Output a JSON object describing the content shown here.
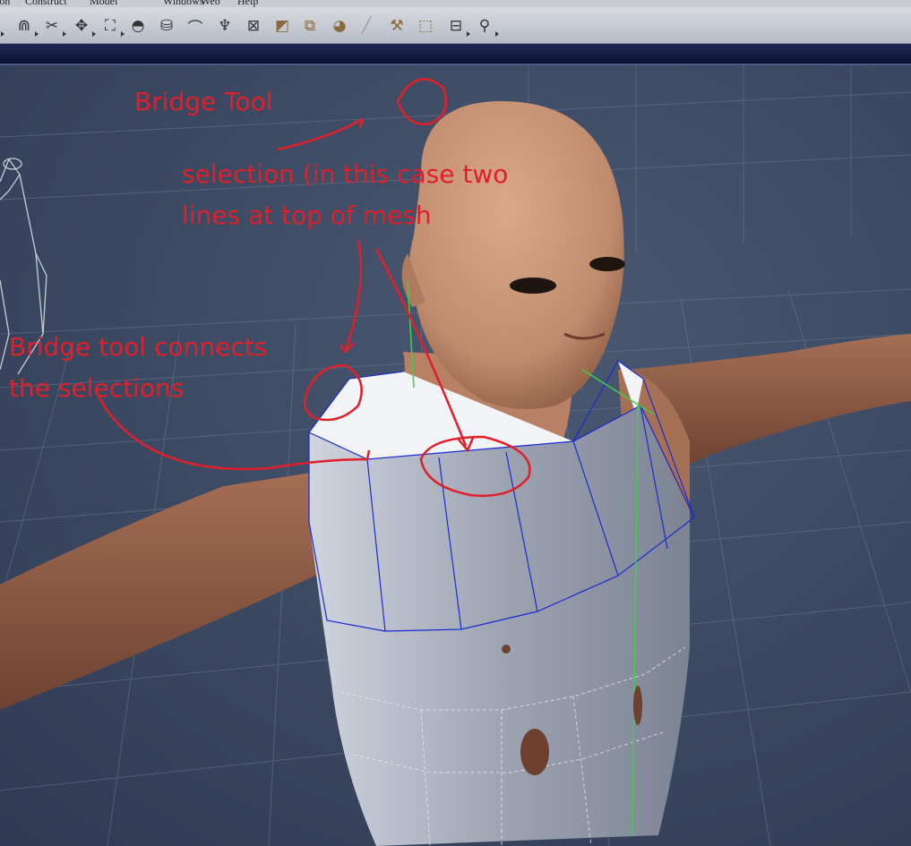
{
  "menu": {
    "items": [
      "ion",
      "Construct",
      "Model",
      "Windows",
      "Web",
      "Help"
    ]
  },
  "toolbar": {
    "tools": [
      {
        "icon": "magnet-icon",
        "glyph": "⋒"
      },
      {
        "icon": "scissors-icon",
        "glyph": "✂"
      },
      {
        "icon": "transform-icon",
        "glyph": "✥"
      },
      {
        "icon": "scale-icon",
        "glyph": "⛶"
      },
      {
        "icon": "dome-icon",
        "glyph": "◓"
      },
      {
        "icon": "extrude-icon",
        "glyph": "⛁"
      },
      {
        "icon": "bend-icon",
        "glyph": "⌒"
      },
      {
        "icon": "cup-icon",
        "glyph": "♆"
      },
      {
        "icon": "box-x-icon",
        "glyph": "⊠"
      },
      {
        "icon": "cube-icon",
        "glyph": "◩"
      },
      {
        "icon": "stack-icon",
        "glyph": "⧉"
      },
      {
        "icon": "sphere-icon",
        "glyph": "◕"
      },
      {
        "icon": "pen-icon",
        "glyph": "╱"
      },
      {
        "icon": "weld-icon",
        "glyph": "⚒"
      },
      {
        "icon": "bridge-tool-icon",
        "glyph": "⬚"
      },
      {
        "icon": "stamp-icon",
        "glyph": "⊟"
      },
      {
        "icon": "sculpt-icon",
        "glyph": "⚲"
      }
    ]
  },
  "annotations": {
    "bridge_tool": "Bridge Tool",
    "selection_line1": "selection (in this case two",
    "selection_line2": "lines at top of mesh",
    "connects_line1": "Bridge tool connects",
    "connects_line2": "the selections"
  },
  "colors": {
    "annotation": "#e11f2b",
    "viewport_background": "#3d4b64",
    "wireframe_blue": "#1a2bd0",
    "skin": "#c89274",
    "mesh": "#a8aebb"
  }
}
